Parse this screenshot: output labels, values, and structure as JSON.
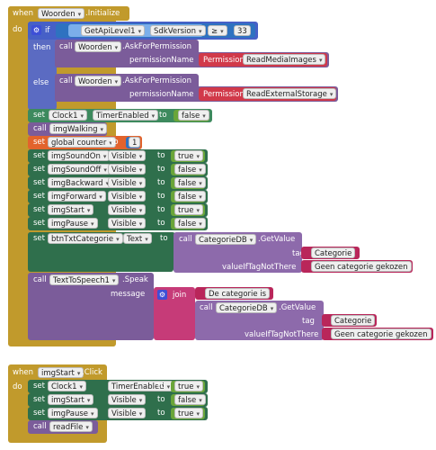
{
  "event1": {
    "when": "when",
    "component": "Woorden",
    "event": ".Initialize",
    "do": "do",
    "if_label": "if",
    "then_label": "then",
    "else_label": "else",
    "api_component": "GetApiLevel1",
    "api_prop": "SdkVersion",
    "op": "≥",
    "api_value": "33",
    "call1": {
      "call": "call",
      "component": "Woorden",
      "method": ".AskForPermission",
      "param": "permissionName",
      "perm_label": "Permission",
      "perm_value": "ReadMediaImages"
    },
    "call2": {
      "call": "call",
      "component": "Woorden",
      "method": ".AskForPermission",
      "param": "permissionName",
      "perm_label": "Permission",
      "perm_value": "ReadExternalStorage"
    },
    "set_clock": {
      "set": "set",
      "component": "Clock1",
      "prop": "TimerEnabled",
      "to": "to",
      "value": "false"
    },
    "call_walk": {
      "call": "call",
      "target": "imgWalking"
    },
    "set_global": {
      "set": "set",
      "var": "global counter",
      "to": "to",
      "value": "1"
    },
    "sets": [
      {
        "set": "set",
        "component": "imgSoundOn",
        "prop": "Visible",
        "to": "to",
        "value": "true"
      },
      {
        "set": "set",
        "component": "imgSoundOff",
        "prop": "Visible",
        "to": "to",
        "value": "false"
      },
      {
        "set": "set",
        "component": "imgBackward",
        "prop": "Visible",
        "to": "to",
        "value": "false"
      },
      {
        "set": "set",
        "component": "imgForward",
        "prop": "Visible",
        "to": "to",
        "value": "false"
      },
      {
        "set": "set",
        "component": "imgStart",
        "prop": "Visible",
        "to": "to",
        "value": "true"
      },
      {
        "set": "set",
        "component": "imgPause",
        "prop": "Visible",
        "to": "to",
        "value": "false"
      }
    ],
    "set_btn": {
      "set": "set",
      "component": "btnTxtCategorie",
      "prop": "Text",
      "to": "to",
      "call": "call",
      "db": "CategorieDB",
      "method": ".GetValue",
      "tag": "tag",
      "tag_value": "Categorie",
      "ifnot": "valueIfTagNotThere",
      "ifnot_value": "Geen categorie gekozen"
    },
    "speak": {
      "call": "call",
      "component": "TextToSpeech1",
      "method": ".Speak",
      "param": "message",
      "join": "join",
      "str1": "De categorie is ",
      "db": "CategorieDB",
      "method2": ".GetValue",
      "tag": "tag",
      "tag_value": "Categorie",
      "ifnot": "valueIfTagNotThere",
      "ifnot_value": "Geen categorie gekozen"
    }
  },
  "event2": {
    "when": "when",
    "component": "imgStart",
    "event": ".Click",
    "do": "do",
    "sets": [
      {
        "set": "set",
        "component": "Clock1",
        "prop": "TimerEnabled",
        "to": "to",
        "value": "true"
      },
      {
        "set": "set",
        "component": "imgStart",
        "prop": "Visible",
        "to": "to",
        "value": "false"
      },
      {
        "set": "set",
        "component": "imgPause",
        "prop": "Visible",
        "to": "to",
        "value": "true"
      }
    ],
    "call_read": {
      "call": "call",
      "target": "readFile"
    }
  }
}
